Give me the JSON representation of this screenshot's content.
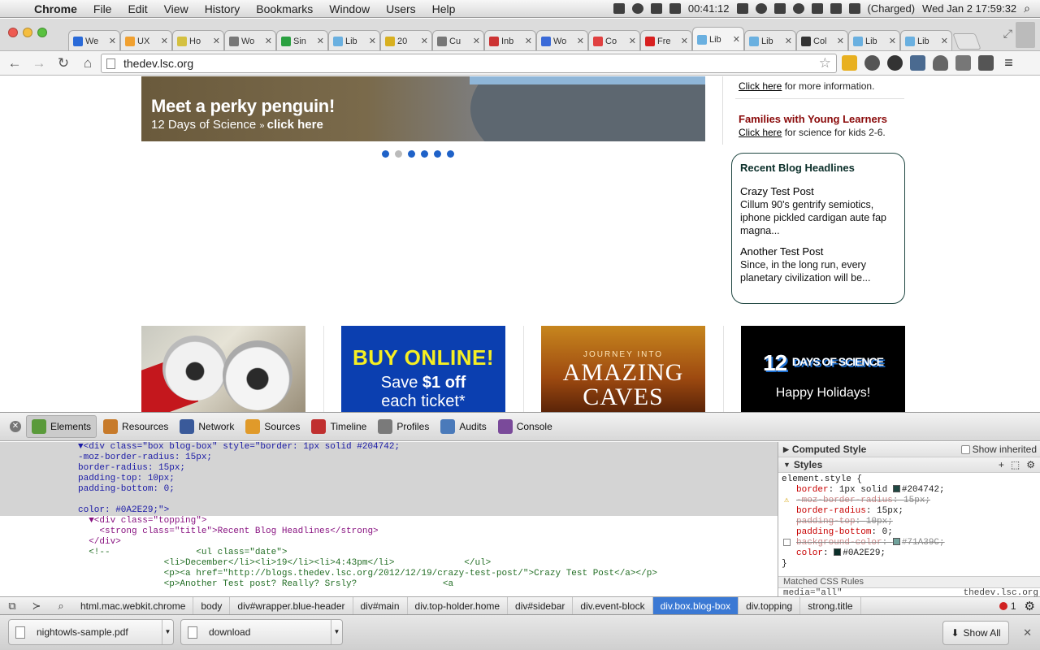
{
  "menubar": {
    "app": "Chrome",
    "items": [
      "File",
      "Edit",
      "View",
      "History",
      "Bookmarks",
      "Window",
      "Users",
      "Help"
    ],
    "time_elapsed": "00:41:12",
    "battery": "(Charged)",
    "datetime": "Wed Jan 2   17:59:32"
  },
  "tabs": [
    {
      "label": "We",
      "color": "#2a6ad8"
    },
    {
      "label": "UX",
      "color": "#f0a030"
    },
    {
      "label": "Ho",
      "color": "#d4c040"
    },
    {
      "label": "Wo",
      "color": "#777777"
    },
    {
      "label": "Sin",
      "color": "#2aa040"
    },
    {
      "label": "Lib",
      "color": "#6ab0e0"
    },
    {
      "label": "20",
      "color": "#d8b020"
    },
    {
      "label": "Cu",
      "color": "#777777"
    },
    {
      "label": "Inb",
      "color": "#cc3333"
    },
    {
      "label": "Wo",
      "color": "#3a6ad8"
    },
    {
      "label": "Co",
      "color": "#e04040"
    },
    {
      "label": "Fre",
      "color": "#d82020"
    },
    {
      "label": "Lib",
      "color": "#6ab0e0",
      "active": true
    },
    {
      "label": "Lib",
      "color": "#6ab0e0"
    },
    {
      "label": "Col",
      "color": "#333333"
    },
    {
      "label": "Lib",
      "color": "#6ab0e0"
    },
    {
      "label": "Lib",
      "color": "#6ab0e0"
    }
  ],
  "toolbar": {
    "url": "thedev.lsc.org"
  },
  "page": {
    "hero_title": "Meet a perky penguin!",
    "hero_sub_prefix": "12 Days of Science",
    "hero_sub_link": "click here",
    "carousel_active_index": 1,
    "side_link1": "Click here",
    "side_text1": " for more information.",
    "families_heading": "Families with Young Learners",
    "side_link2": "Click here",
    "side_text2": " for science for kids 2-6.",
    "blog": {
      "title": "Recent Blog Headlines",
      "posts": [
        {
          "title": "Crazy Test Post",
          "body": "Cillum 90's gentrify semiotics, iphone pickled cardigan aute fap magna..."
        },
        {
          "title": "Another Test Post",
          "body": "Since, in the long run, every planetary civilization will be..."
        }
      ]
    },
    "promo2": {
      "big": "BUY ONLINE!",
      "line2_pre": "Save ",
      "line2_bold": "$1 off",
      "line3": "each ticket*"
    },
    "promo3": {
      "small": "JOURNEY INTO",
      "big1": "AMAZING",
      "big2": "CAVES"
    },
    "promo4": {
      "num": "12",
      "rest": "DAYS OF SCIENCE",
      "sub": "Happy Holidays!"
    }
  },
  "devtools": {
    "panels": [
      "Elements",
      "Resources",
      "Network",
      "Sources",
      "Timeline",
      "Profiles",
      "Audits",
      "Console"
    ],
    "active_panel": "Elements",
    "code": [
      "▼<div class=\"box blog-box\" style=\"border: 1px solid #204742;",
      "-moz-border-radius: 15px;",
      "border-radius: 15px;",
      "padding-top: 10px;",
      "padding-bottom: 0;",
      "",
      "color: #0A2E29;\">",
      "  ▼<div class=\"topping\">",
      "    <strong class=\"title\">Recent Blog Headlines</strong>",
      "  </div>",
      "  <!--                <ul class=\"date\">",
      "                <li>December</li><li>19</li><li>4:43pm</li>             </ul>",
      "                <p><a href=\"http://blogs.thedev.lsc.org/2012/12/19/crazy-test-post/\">Crazy Test Post</a></p>",
      "                <p>Another Test post? Really? Srsly?                <a"
    ],
    "computed_style": "Computed Style",
    "show_inherited": "Show inherited",
    "styles": "Styles",
    "element_style": "element.style {",
    "style_props": [
      {
        "name": "border",
        "value": "1px solid",
        "swatch": "#204742",
        "value2": "#204742;",
        "strike": false
      },
      {
        "name": "-moz-border-radius",
        "value": "15px;",
        "strike": true,
        "warn": true
      },
      {
        "name": "border-radius",
        "value": "15px;",
        "strike": false
      },
      {
        "name": "padding-top",
        "value": "10px;",
        "strike": true
      },
      {
        "name": "padding-bottom",
        "value": "0;",
        "strike": false
      },
      {
        "name": "background-color",
        "value": "",
        "swatch": "#71A39C",
        "value2": "#71A39C;",
        "strike": true,
        "checkbox": true
      },
      {
        "name": "color",
        "value": "",
        "swatch": "#0A2E29",
        "value2": "#0A2E29;",
        "strike": false
      }
    ],
    "close_brace": "}",
    "matched_rules": "Matched CSS Rules",
    "media": "media=\"all\"",
    "media_src": "thedev.lsc.org",
    "breadcrumbs": [
      "html.mac.webkit.chrome",
      "body",
      "div#wrapper.blue-header",
      "div#main",
      "div.top-holder.home",
      "div#sidebar",
      "div.event-block",
      "div.box.blog-box",
      "div.topping",
      "strong.title"
    ],
    "active_crumb": "div.box.blog-box",
    "error_count": "1"
  },
  "downloads": {
    "items": [
      "nightowls-sample.pdf",
      "download"
    ],
    "show_all": "Show All"
  }
}
